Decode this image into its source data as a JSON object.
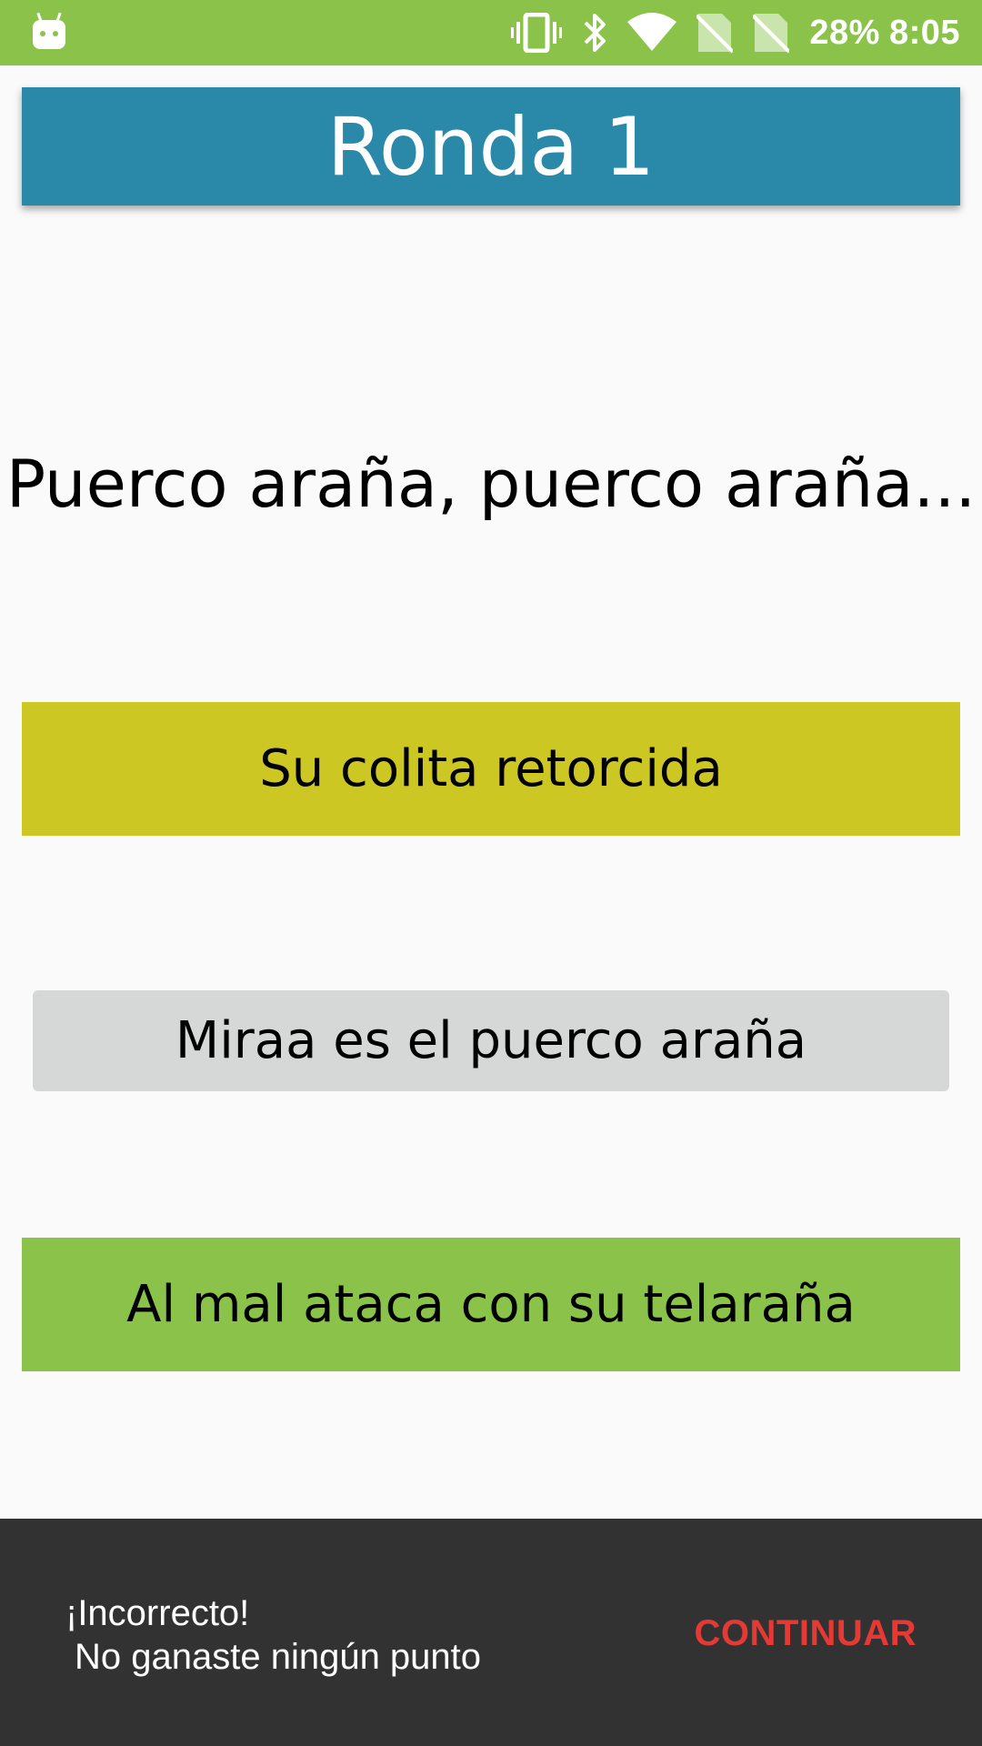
{
  "status_bar": {
    "battery": "28%",
    "time": "8:05",
    "icons": [
      "android-debug-icon",
      "vibrate-icon",
      "bluetooth-icon",
      "wifi-icon",
      "no-sim-icon",
      "no-sim-icon"
    ]
  },
  "header": {
    "title": "Ronda 1"
  },
  "question": {
    "text": "Puerco araña, puerco araña..."
  },
  "options": [
    {
      "label": "Su colita retorcida",
      "color": "#cdc723"
    },
    {
      "label": "Miraa es el puerco araña",
      "color": "#d6d7d7"
    },
    {
      "label": "Al mal ataca con su telaraña",
      "color": "#8bc34a"
    }
  ],
  "snackbar": {
    "line1": "¡Incorrecto!",
    "line2": "No ganaste ningún punto",
    "action": "CONTINUAR"
  },
  "colors": {
    "status_bar": "#8bc34a",
    "header": "#2a89a8",
    "snackbar": "#323232",
    "action": "#e53935"
  }
}
